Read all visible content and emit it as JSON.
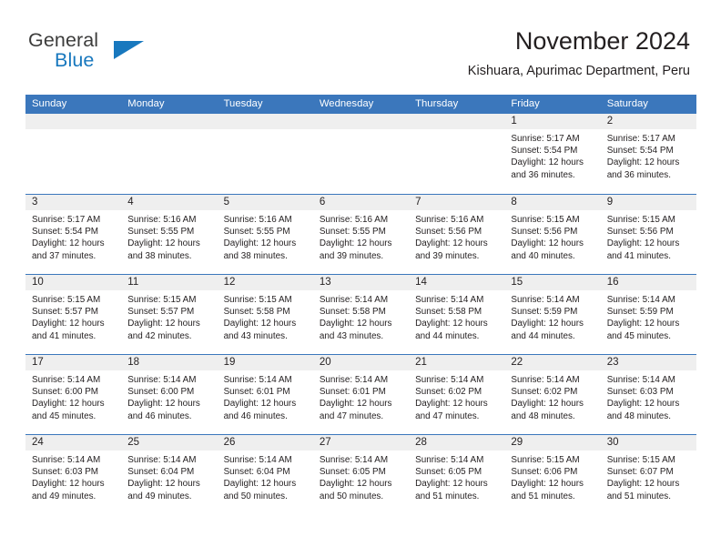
{
  "brand": {
    "name_part1": "General",
    "name_part2": "Blue",
    "accent_color": "#1878be"
  },
  "header": {
    "month_title": "November 2024",
    "location": "Kishuara, Apurimac Department, Peru"
  },
  "theme": {
    "header_blue": "#3b77bc",
    "day_band_gray": "#efefef",
    "text_color": "#231f20"
  },
  "calendar": {
    "day_headers": [
      "Sunday",
      "Monday",
      "Tuesday",
      "Wednesday",
      "Thursday",
      "Friday",
      "Saturday"
    ],
    "labels": {
      "sunrise_prefix": "Sunrise:",
      "sunset_prefix": "Sunset:",
      "daylight_prefix": "Daylight:"
    },
    "weeks": [
      [
        {
          "day": "",
          "empty": true
        },
        {
          "day": "",
          "empty": true
        },
        {
          "day": "",
          "empty": true
        },
        {
          "day": "",
          "empty": true
        },
        {
          "day": "",
          "empty": true
        },
        {
          "day": "1",
          "sunrise": "Sunrise: 5:17 AM",
          "sunset": "Sunset: 5:54 PM",
          "daylight_line1": "Daylight: 12 hours",
          "daylight_line2": "and 36 minutes."
        },
        {
          "day": "2",
          "sunrise": "Sunrise: 5:17 AM",
          "sunset": "Sunset: 5:54 PM",
          "daylight_line1": "Daylight: 12 hours",
          "daylight_line2": "and 36 minutes."
        }
      ],
      [
        {
          "day": "3",
          "sunrise": "Sunrise: 5:17 AM",
          "sunset": "Sunset: 5:54 PM",
          "daylight_line1": "Daylight: 12 hours",
          "daylight_line2": "and 37 minutes."
        },
        {
          "day": "4",
          "sunrise": "Sunrise: 5:16 AM",
          "sunset": "Sunset: 5:55 PM",
          "daylight_line1": "Daylight: 12 hours",
          "daylight_line2": "and 38 minutes."
        },
        {
          "day": "5",
          "sunrise": "Sunrise: 5:16 AM",
          "sunset": "Sunset: 5:55 PM",
          "daylight_line1": "Daylight: 12 hours",
          "daylight_line2": "and 38 minutes."
        },
        {
          "day": "6",
          "sunrise": "Sunrise: 5:16 AM",
          "sunset": "Sunset: 5:55 PM",
          "daylight_line1": "Daylight: 12 hours",
          "daylight_line2": "and 39 minutes."
        },
        {
          "day": "7",
          "sunrise": "Sunrise: 5:16 AM",
          "sunset": "Sunset: 5:56 PM",
          "daylight_line1": "Daylight: 12 hours",
          "daylight_line2": "and 39 minutes."
        },
        {
          "day": "8",
          "sunrise": "Sunrise: 5:15 AM",
          "sunset": "Sunset: 5:56 PM",
          "daylight_line1": "Daylight: 12 hours",
          "daylight_line2": "and 40 minutes."
        },
        {
          "day": "9",
          "sunrise": "Sunrise: 5:15 AM",
          "sunset": "Sunset: 5:56 PM",
          "daylight_line1": "Daylight: 12 hours",
          "daylight_line2": "and 41 minutes."
        }
      ],
      [
        {
          "day": "10",
          "sunrise": "Sunrise: 5:15 AM",
          "sunset": "Sunset: 5:57 PM",
          "daylight_line1": "Daylight: 12 hours",
          "daylight_line2": "and 41 minutes."
        },
        {
          "day": "11",
          "sunrise": "Sunrise: 5:15 AM",
          "sunset": "Sunset: 5:57 PM",
          "daylight_line1": "Daylight: 12 hours",
          "daylight_line2": "and 42 minutes."
        },
        {
          "day": "12",
          "sunrise": "Sunrise: 5:15 AM",
          "sunset": "Sunset: 5:58 PM",
          "daylight_line1": "Daylight: 12 hours",
          "daylight_line2": "and 43 minutes."
        },
        {
          "day": "13",
          "sunrise": "Sunrise: 5:14 AM",
          "sunset": "Sunset: 5:58 PM",
          "daylight_line1": "Daylight: 12 hours",
          "daylight_line2": "and 43 minutes."
        },
        {
          "day": "14",
          "sunrise": "Sunrise: 5:14 AM",
          "sunset": "Sunset: 5:58 PM",
          "daylight_line1": "Daylight: 12 hours",
          "daylight_line2": "and 44 minutes."
        },
        {
          "day": "15",
          "sunrise": "Sunrise: 5:14 AM",
          "sunset": "Sunset: 5:59 PM",
          "daylight_line1": "Daylight: 12 hours",
          "daylight_line2": "and 44 minutes."
        },
        {
          "day": "16",
          "sunrise": "Sunrise: 5:14 AM",
          "sunset": "Sunset: 5:59 PM",
          "daylight_line1": "Daylight: 12 hours",
          "daylight_line2": "and 45 minutes."
        }
      ],
      [
        {
          "day": "17",
          "sunrise": "Sunrise: 5:14 AM",
          "sunset": "Sunset: 6:00 PM",
          "daylight_line1": "Daylight: 12 hours",
          "daylight_line2": "and 45 minutes."
        },
        {
          "day": "18",
          "sunrise": "Sunrise: 5:14 AM",
          "sunset": "Sunset: 6:00 PM",
          "daylight_line1": "Daylight: 12 hours",
          "daylight_line2": "and 46 minutes."
        },
        {
          "day": "19",
          "sunrise": "Sunrise: 5:14 AM",
          "sunset": "Sunset: 6:01 PM",
          "daylight_line1": "Daylight: 12 hours",
          "daylight_line2": "and 46 minutes."
        },
        {
          "day": "20",
          "sunrise": "Sunrise: 5:14 AM",
          "sunset": "Sunset: 6:01 PM",
          "daylight_line1": "Daylight: 12 hours",
          "daylight_line2": "and 47 minutes."
        },
        {
          "day": "21",
          "sunrise": "Sunrise: 5:14 AM",
          "sunset": "Sunset: 6:02 PM",
          "daylight_line1": "Daylight: 12 hours",
          "daylight_line2": "and 47 minutes."
        },
        {
          "day": "22",
          "sunrise": "Sunrise: 5:14 AM",
          "sunset": "Sunset: 6:02 PM",
          "daylight_line1": "Daylight: 12 hours",
          "daylight_line2": "and 48 minutes."
        },
        {
          "day": "23",
          "sunrise": "Sunrise: 5:14 AM",
          "sunset": "Sunset: 6:03 PM",
          "daylight_line1": "Daylight: 12 hours",
          "daylight_line2": "and 48 minutes."
        }
      ],
      [
        {
          "day": "24",
          "sunrise": "Sunrise: 5:14 AM",
          "sunset": "Sunset: 6:03 PM",
          "daylight_line1": "Daylight: 12 hours",
          "daylight_line2": "and 49 minutes."
        },
        {
          "day": "25",
          "sunrise": "Sunrise: 5:14 AM",
          "sunset": "Sunset: 6:04 PM",
          "daylight_line1": "Daylight: 12 hours",
          "daylight_line2": "and 49 minutes."
        },
        {
          "day": "26",
          "sunrise": "Sunrise: 5:14 AM",
          "sunset": "Sunset: 6:04 PM",
          "daylight_line1": "Daylight: 12 hours",
          "daylight_line2": "and 50 minutes."
        },
        {
          "day": "27",
          "sunrise": "Sunrise: 5:14 AM",
          "sunset": "Sunset: 6:05 PM",
          "daylight_line1": "Daylight: 12 hours",
          "daylight_line2": "and 50 minutes."
        },
        {
          "day": "28",
          "sunrise": "Sunrise: 5:14 AM",
          "sunset": "Sunset: 6:05 PM",
          "daylight_line1": "Daylight: 12 hours",
          "daylight_line2": "and 51 minutes."
        },
        {
          "day": "29",
          "sunrise": "Sunrise: 5:15 AM",
          "sunset": "Sunset: 6:06 PM",
          "daylight_line1": "Daylight: 12 hours",
          "daylight_line2": "and 51 minutes."
        },
        {
          "day": "30",
          "sunrise": "Sunrise: 5:15 AM",
          "sunset": "Sunset: 6:07 PM",
          "daylight_line1": "Daylight: 12 hours",
          "daylight_line2": "and 51 minutes."
        }
      ]
    ]
  }
}
